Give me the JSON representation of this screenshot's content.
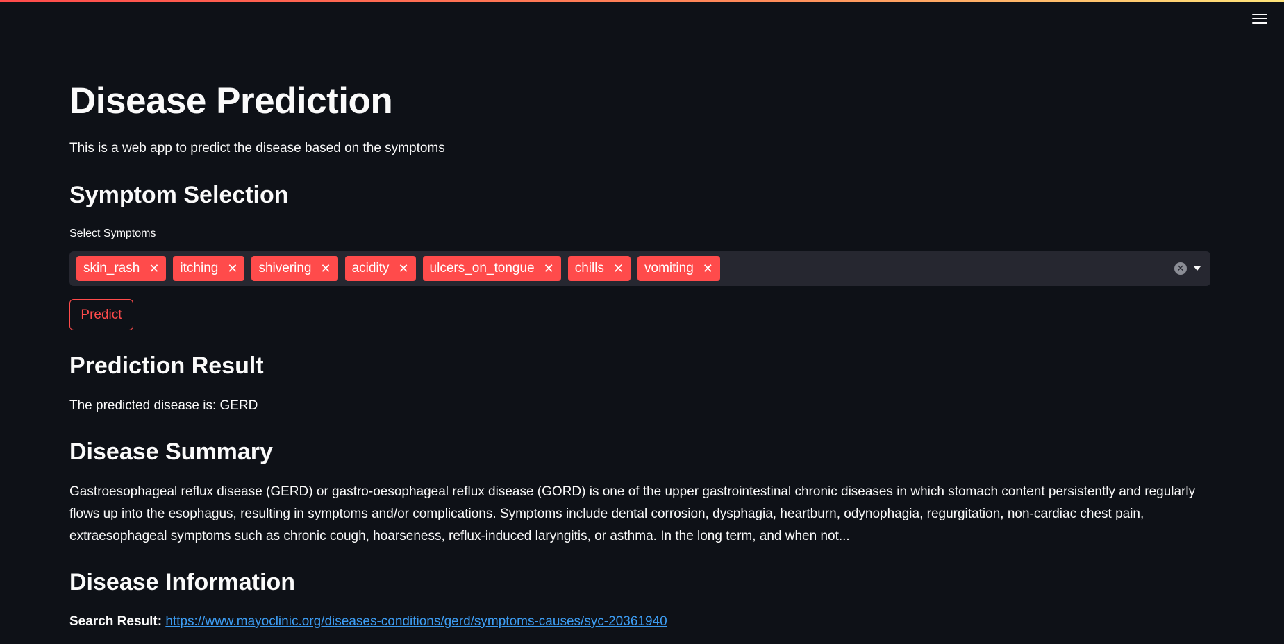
{
  "app": {
    "title": "Disease Prediction",
    "subtitle": "This is a web app to predict the disease based on the symptoms"
  },
  "symptom_section": {
    "heading": "Symptom Selection",
    "select_label": "Select Symptoms",
    "selected": [
      "skin_rash",
      "itching",
      "shivering",
      "acidity",
      "ulcers_on_tongue",
      "chills",
      "vomiting"
    ],
    "remove_glyph": "✕",
    "clear_all_glyph": "✕"
  },
  "predict_button": {
    "label": "Predict"
  },
  "result_section": {
    "heading": "Prediction Result",
    "text": "The predicted disease is: GERD"
  },
  "summary_section": {
    "heading": "Disease Summary",
    "text": "Gastroesophageal reflux disease (GERD) or gastro-oesophageal reflux disease (GORD) is one of the upper gastrointestinal chronic diseases in which stomach content persistently and regularly flows up into the esophagus, resulting in symptoms and/or complications. Symptoms include dental corrosion, dysphagia, heartburn, odynophagia, regurgitation, non-cardiac chest pain, extraesophageal symptoms such as chronic cough, hoarseness, reflux-induced laryngitis, or asthma. In the long term, and when not..."
  },
  "info_section": {
    "heading": "Disease Information",
    "search_label": "Search Result:",
    "link": "https://www.mayoclinic.org/diseases-conditions/gerd/symptoms-causes/syc-20361940"
  },
  "icons": {
    "menu": "hamburger-menu-icon",
    "remove": "close-icon",
    "clear": "clear-circle-icon",
    "dropdown": "caret-down-icon"
  },
  "colors": {
    "background": "#0e1117",
    "accent": "#ff4b4b",
    "input_bg": "#262730",
    "link": "#3d9df3",
    "text": "#fafafa"
  }
}
